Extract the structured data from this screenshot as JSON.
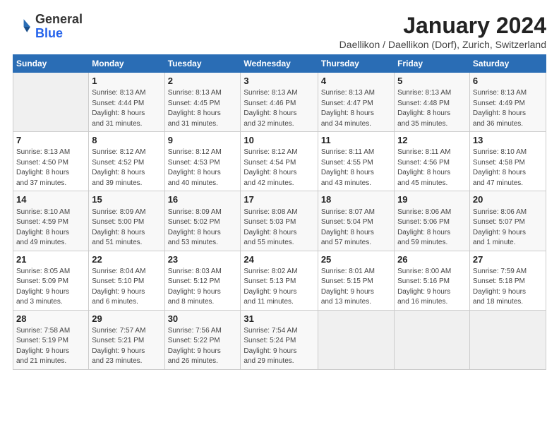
{
  "header": {
    "logo_general": "General",
    "logo_blue": "Blue",
    "title": "January 2024",
    "subtitle": "Daellikon / Daellikon (Dorf), Zurich, Switzerland"
  },
  "columns": [
    "Sunday",
    "Monday",
    "Tuesday",
    "Wednesday",
    "Thursday",
    "Friday",
    "Saturday"
  ],
  "weeks": [
    [
      {
        "day": "",
        "info": ""
      },
      {
        "day": "1",
        "info": "Sunrise: 8:13 AM\nSunset: 4:44 PM\nDaylight: 8 hours\nand 31 minutes."
      },
      {
        "day": "2",
        "info": "Sunrise: 8:13 AM\nSunset: 4:45 PM\nDaylight: 8 hours\nand 31 minutes."
      },
      {
        "day": "3",
        "info": "Sunrise: 8:13 AM\nSunset: 4:46 PM\nDaylight: 8 hours\nand 32 minutes."
      },
      {
        "day": "4",
        "info": "Sunrise: 8:13 AM\nSunset: 4:47 PM\nDaylight: 8 hours\nand 34 minutes."
      },
      {
        "day": "5",
        "info": "Sunrise: 8:13 AM\nSunset: 4:48 PM\nDaylight: 8 hours\nand 35 minutes."
      },
      {
        "day": "6",
        "info": "Sunrise: 8:13 AM\nSunset: 4:49 PM\nDaylight: 8 hours\nand 36 minutes."
      }
    ],
    [
      {
        "day": "7",
        "info": "Sunrise: 8:13 AM\nSunset: 4:50 PM\nDaylight: 8 hours\nand 37 minutes."
      },
      {
        "day": "8",
        "info": "Sunrise: 8:12 AM\nSunset: 4:52 PM\nDaylight: 8 hours\nand 39 minutes."
      },
      {
        "day": "9",
        "info": "Sunrise: 8:12 AM\nSunset: 4:53 PM\nDaylight: 8 hours\nand 40 minutes."
      },
      {
        "day": "10",
        "info": "Sunrise: 8:12 AM\nSunset: 4:54 PM\nDaylight: 8 hours\nand 42 minutes."
      },
      {
        "day": "11",
        "info": "Sunrise: 8:11 AM\nSunset: 4:55 PM\nDaylight: 8 hours\nand 43 minutes."
      },
      {
        "day": "12",
        "info": "Sunrise: 8:11 AM\nSunset: 4:56 PM\nDaylight: 8 hours\nand 45 minutes."
      },
      {
        "day": "13",
        "info": "Sunrise: 8:10 AM\nSunset: 4:58 PM\nDaylight: 8 hours\nand 47 minutes."
      }
    ],
    [
      {
        "day": "14",
        "info": "Sunrise: 8:10 AM\nSunset: 4:59 PM\nDaylight: 8 hours\nand 49 minutes."
      },
      {
        "day": "15",
        "info": "Sunrise: 8:09 AM\nSunset: 5:00 PM\nDaylight: 8 hours\nand 51 minutes."
      },
      {
        "day": "16",
        "info": "Sunrise: 8:09 AM\nSunset: 5:02 PM\nDaylight: 8 hours\nand 53 minutes."
      },
      {
        "day": "17",
        "info": "Sunrise: 8:08 AM\nSunset: 5:03 PM\nDaylight: 8 hours\nand 55 minutes."
      },
      {
        "day": "18",
        "info": "Sunrise: 8:07 AM\nSunset: 5:04 PM\nDaylight: 8 hours\nand 57 minutes."
      },
      {
        "day": "19",
        "info": "Sunrise: 8:06 AM\nSunset: 5:06 PM\nDaylight: 8 hours\nand 59 minutes."
      },
      {
        "day": "20",
        "info": "Sunrise: 8:06 AM\nSunset: 5:07 PM\nDaylight: 9 hours\nand 1 minute."
      }
    ],
    [
      {
        "day": "21",
        "info": "Sunrise: 8:05 AM\nSunset: 5:09 PM\nDaylight: 9 hours\nand 3 minutes."
      },
      {
        "day": "22",
        "info": "Sunrise: 8:04 AM\nSunset: 5:10 PM\nDaylight: 9 hours\nand 6 minutes."
      },
      {
        "day": "23",
        "info": "Sunrise: 8:03 AM\nSunset: 5:12 PM\nDaylight: 9 hours\nand 8 minutes."
      },
      {
        "day": "24",
        "info": "Sunrise: 8:02 AM\nSunset: 5:13 PM\nDaylight: 9 hours\nand 11 minutes."
      },
      {
        "day": "25",
        "info": "Sunrise: 8:01 AM\nSunset: 5:15 PM\nDaylight: 9 hours\nand 13 minutes."
      },
      {
        "day": "26",
        "info": "Sunrise: 8:00 AM\nSunset: 5:16 PM\nDaylight: 9 hours\nand 16 minutes."
      },
      {
        "day": "27",
        "info": "Sunrise: 7:59 AM\nSunset: 5:18 PM\nDaylight: 9 hours\nand 18 minutes."
      }
    ],
    [
      {
        "day": "28",
        "info": "Sunrise: 7:58 AM\nSunset: 5:19 PM\nDaylight: 9 hours\nand 21 minutes."
      },
      {
        "day": "29",
        "info": "Sunrise: 7:57 AM\nSunset: 5:21 PM\nDaylight: 9 hours\nand 23 minutes."
      },
      {
        "day": "30",
        "info": "Sunrise: 7:56 AM\nSunset: 5:22 PM\nDaylight: 9 hours\nand 26 minutes."
      },
      {
        "day": "31",
        "info": "Sunrise: 7:54 AM\nSunset: 5:24 PM\nDaylight: 9 hours\nand 29 minutes."
      },
      {
        "day": "",
        "info": ""
      },
      {
        "day": "",
        "info": ""
      },
      {
        "day": "",
        "info": ""
      }
    ]
  ]
}
